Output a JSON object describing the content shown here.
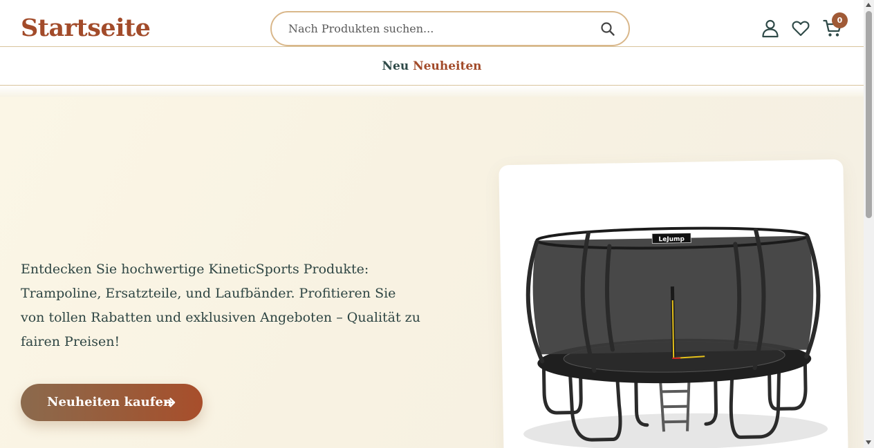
{
  "header": {
    "logo": "Startseite",
    "search": {
      "placeholder": "Nach Produkten suchen...",
      "value": ""
    },
    "cart_count": "0",
    "icons": [
      "search-icon",
      "user-icon",
      "heart-icon",
      "cart-icon"
    ]
  },
  "nav": {
    "item_new": "Neu",
    "item_news": "Neuheiten"
  },
  "hero": {
    "text": "Entdecken Sie hochwertige KineticSports Produkte: Trampoline, Ersatzteile, und Laufbänder. Profitieren Sie von tollen Rabatten und exklusiven Angeboten – Qualität zu fairen Preisen!",
    "cta_label": "Neuheiten kaufen",
    "image_brand_label": "LeJump"
  },
  "colors": {
    "brand": "#a24b2a",
    "accent_border": "#d9b78a",
    "text": "#2f4a48",
    "hero_bg": "#fbf6e6"
  }
}
